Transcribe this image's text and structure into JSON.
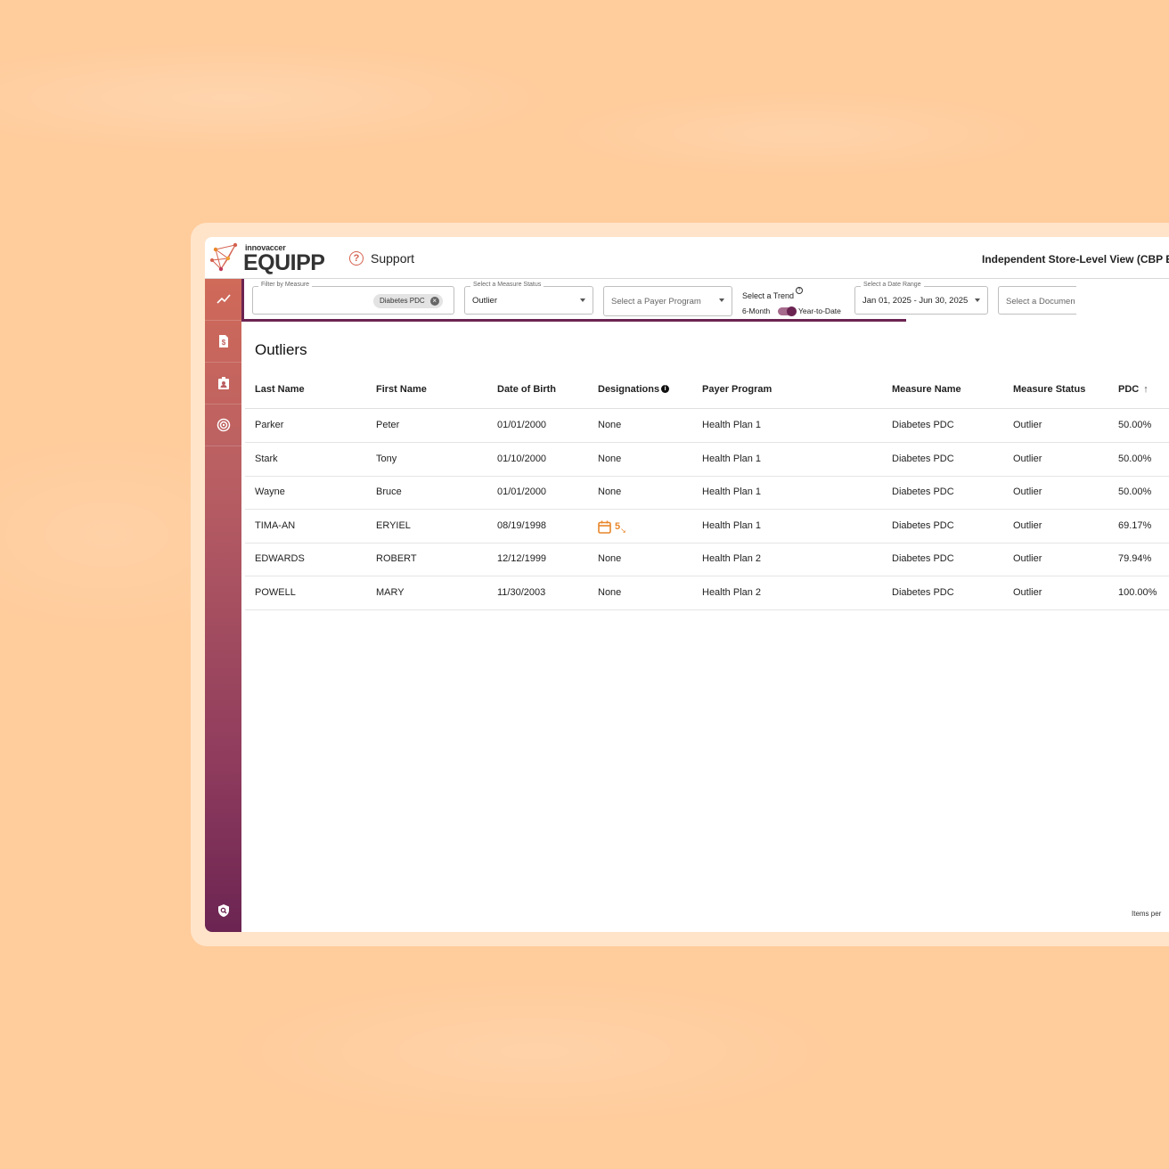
{
  "header": {
    "brand_small": "innovaccer",
    "brand_big": "EQUIPP",
    "support_label": "Support",
    "view_title": "Independent Store-Level View (CBP Enha"
  },
  "sidebar": {
    "items": [
      "trend-chart-icon",
      "billing-document-icon",
      "patient-badge-icon",
      "target-icon"
    ],
    "bottom": "shield-search-icon"
  },
  "filters": {
    "measure": {
      "legend": "Filter by Measure",
      "chip": "Diabetes PDC"
    },
    "status": {
      "legend": "Select a Measure Status",
      "value": "Outlier"
    },
    "payer": {
      "placeholder": "Select a Payer Program"
    },
    "trend": {
      "label": "Select a Trend",
      "left": "6-Month",
      "right": "Year-to-Date"
    },
    "date_range": {
      "legend": "Select a Date Range",
      "value": "Jan 01, 2025 - Jun 30, 2025"
    },
    "document": {
      "placeholder": "Select a Documen"
    }
  },
  "section_title": "Outliers",
  "table": {
    "columns": [
      "Last Name",
      "First Name",
      "Date of Birth",
      "Designations",
      "Payer Program",
      "Measure Name",
      "Measure Status",
      "PDC"
    ],
    "rows": [
      [
        "Parker",
        "Peter",
        "01/01/2000",
        "None",
        "Health Plan 1",
        "Diabetes PDC",
        "Outlier",
        "50.00%"
      ],
      [
        "Stark",
        "Tony",
        "01/10/2000",
        "None",
        "Health Plan 1",
        "Diabetes PDC",
        "Outlier",
        "50.00%"
      ],
      [
        "Wayne",
        "Bruce",
        "01/01/2000",
        "None",
        "Health Plan 1",
        "Diabetes PDC",
        "Outlier",
        "50.00%"
      ],
      [
        "TIMA-AN",
        "ERYIEL",
        "08/19/1998",
        "",
        "Health Plan 1",
        "Diabetes PDC",
        "Outlier",
        "69.17%"
      ],
      [
        "EDWARDS",
        "ROBERT",
        "12/12/1999",
        "None",
        "Health Plan 2",
        "Diabetes PDC",
        "Outlier",
        "79.94%"
      ],
      [
        "POWELL",
        "MARY",
        "11/30/2003",
        "None",
        "Health Plan 2",
        "Diabetes PDC",
        "Outlier",
        "100.00%"
      ]
    ],
    "designation_icon_label": "5"
  },
  "footer": {
    "items_per": "Items per"
  },
  "colors": {
    "accent": "#6b2452",
    "brand_orange": "#d4614e",
    "designation_orange": "#e8862a"
  }
}
